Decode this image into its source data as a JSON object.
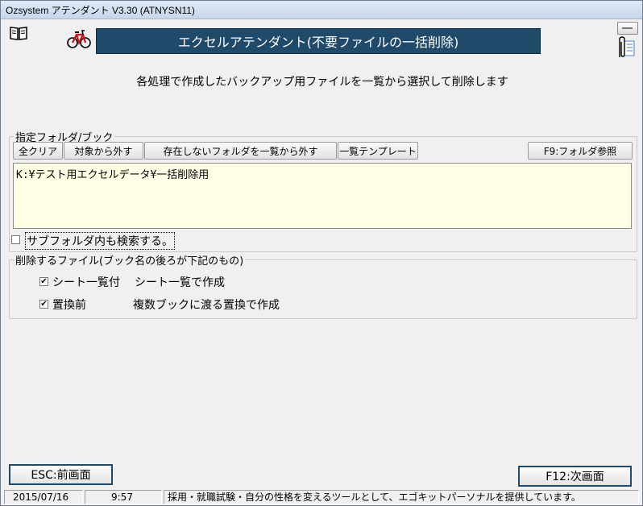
{
  "window": {
    "title": "Ozsystem アテンダント V3.30 (ATNYSN11)"
  },
  "icons": {
    "book": "book-icon",
    "bicycle": "bicycle-icon",
    "minimize": "minimize-icon",
    "clip": "paperclip-icon"
  },
  "header": {
    "banner": "エクセルアテンダント(不要ファイルの一括削除)",
    "subtitle": "各処理で作成したバックアップ用ファイルを一覧から選択して削除します"
  },
  "folder_group": {
    "label": "指定フォルダ/ブック",
    "buttons": {
      "clear_all": "全クリア",
      "remove_target": "対象から外す",
      "remove_missing": "存在しないフォルダを一覧から外す",
      "template": "一覧テンプレート",
      "browse": "F9:フォルダ参照"
    },
    "folder_path": "K:¥テスト用エクセルデータ¥一括削除用",
    "subfolder_checkbox": {
      "label": "サブフォルダ内も検索する。",
      "checked": false
    }
  },
  "delete_group": {
    "label": "削除するファイル(ブック名の後ろが下記のもの)",
    "items": [
      {
        "checked": true,
        "name": "シート一覧付",
        "desc": "シート一覧で作成"
      },
      {
        "checked": true,
        "name": "置換前",
        "desc": "複数ブックに渡る置換で作成"
      }
    ]
  },
  "footer": {
    "back_button": "ESC:前画面",
    "next_button": "F12:次画面"
  },
  "statusbar": {
    "date": "2015/07/16",
    "time": "9:57",
    "message": "採用・就職試験・自分の性格を変えるツールとして、エゴキットパーソナルを提供しています。"
  },
  "colors": {
    "banner_bg": "#1f4a6a",
    "input_bg": "#ffffe6"
  }
}
